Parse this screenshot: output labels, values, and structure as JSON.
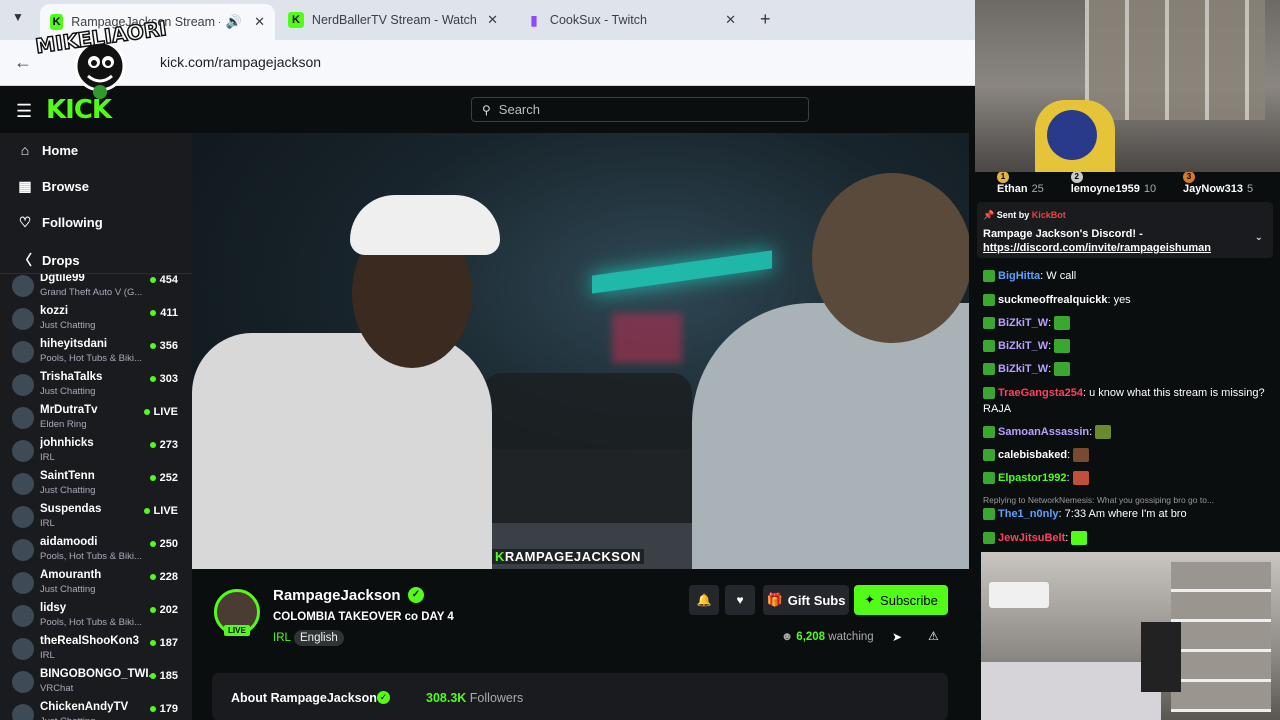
{
  "browser": {
    "tabs": [
      {
        "title": "RampageJackson Stream - ",
        "icon": "kick-favicon",
        "active": true
      },
      {
        "title": "NerdBallerTV Stream - Watch L",
        "icon": "kick-favicon",
        "active": false
      },
      {
        "title": "CookSux - Twitch",
        "icon": "twitch-favicon",
        "active": false
      }
    ],
    "new_tab": "+",
    "url": "kick.com/rampagejackson",
    "overlay_logo": "MIKELIAORI"
  },
  "header": {
    "logo": "KICK",
    "search_placeholder": "Search"
  },
  "sidebar": {
    "nav": [
      {
        "label": "Home",
        "icon": "home-icon"
      },
      {
        "label": "Browse",
        "icon": "browse-icon"
      },
      {
        "label": "Following",
        "icon": "heart-icon"
      },
      {
        "label": "Drops",
        "icon": "drops-icon"
      }
    ],
    "channels": [
      {
        "name": "Dgtile99",
        "category": "Grand Theft Auto V (G...",
        "viewers": "454"
      },
      {
        "name": "kozzi",
        "category": "Just Chatting",
        "viewers": "411"
      },
      {
        "name": "hiheyitsdani",
        "category": "Pools, Hot Tubs & Biki...",
        "viewers": "356"
      },
      {
        "name": "TrishaTalks",
        "category": "Just Chatting",
        "viewers": "303"
      },
      {
        "name": "MrDutraTv",
        "category": "Elden Ring",
        "viewers": "LIVE"
      },
      {
        "name": "johnhicks",
        "category": "IRL",
        "viewers": "273"
      },
      {
        "name": "SaintTenn",
        "category": "Just Chatting",
        "viewers": "252"
      },
      {
        "name": "Suspendas",
        "category": "IRL",
        "viewers": "LIVE"
      },
      {
        "name": "aidamoodi",
        "category": "Pools, Hot Tubs & Biki...",
        "viewers": "250"
      },
      {
        "name": "Amouranth",
        "category": "Just Chatting",
        "viewers": "228"
      },
      {
        "name": "lidsy",
        "category": "Pools, Hot Tubs & Biki...",
        "viewers": "202"
      },
      {
        "name": "theRealShooKon3",
        "category": "IRL",
        "viewers": "187"
      },
      {
        "name": "BINGOBONGO_TWI...",
        "category": "VRChat",
        "viewers": "185"
      },
      {
        "name": "ChickenAndyTV",
        "category": "Just Chatting",
        "viewers": "179"
      }
    ]
  },
  "video": {
    "watermark_k": "K",
    "watermark": "RAMPAGEJACKSON"
  },
  "stream": {
    "channel": "RampageJackson",
    "live": "LIVE",
    "title": "COLOMBIA TAKEOVER co DAY 4",
    "category": "IRL",
    "language": "English",
    "gift_label": "Gift Subs",
    "subscribe_label": "Subscribe",
    "viewers": "6,208",
    "watching_label": "watching",
    "about_title": "About RampageJackson",
    "followers": "308.3K",
    "followers_label": "Followers"
  },
  "chat": {
    "leaderboard": [
      {
        "rank": "1",
        "name": "Ethan",
        "count": "25"
      },
      {
        "rank": "2",
        "name": "lemoyne1959",
        "count": "10"
      },
      {
        "rank": "3",
        "name": "JayNow313",
        "count": "5"
      }
    ],
    "pinned": {
      "sent_by": "Sent by",
      "sender": "KickBot",
      "line1": "Rampage Jackson's Discord! -",
      "link": "https://discord.com/invite/rampageishuman"
    },
    "messages": [
      {
        "user": "BigHitta",
        "color": "#5aa0ff",
        "text": "W call"
      },
      {
        "user": "suckmeoffrealquickk",
        "color": "#ffffff",
        "text": "yes"
      },
      {
        "user": "BiZkiT_W",
        "color": "#b8a0ff",
        "text": ""
      },
      {
        "user": "BiZkiT_W",
        "color": "#b8a0ff",
        "text": ""
      },
      {
        "user": "BiZkiT_W",
        "color": "#b8a0ff",
        "text": ""
      },
      {
        "user": "TraeGangsta254",
        "color": "#ff4060",
        "text": "u know what this stream is missing? RAJA"
      },
      {
        "user": "SamoanAssassin",
        "color": "#b8a0ff",
        "text": ""
      },
      {
        "user": "calebisbaked",
        "color": "#ffffff",
        "text": ""
      },
      {
        "user": "Elpastor1992",
        "color": "#53fc18",
        "text": ""
      },
      {
        "user": "The1_n0nly",
        "color": "#5aa0ff",
        "text": "7:33 Am where I'm at bro"
      },
      {
        "user": "JewJitsuBelt",
        "color": "#ff4060",
        "text": ""
      }
    ],
    "reply_note": "Replying to NetworkNemesis: What you gossiping bro go to..."
  }
}
